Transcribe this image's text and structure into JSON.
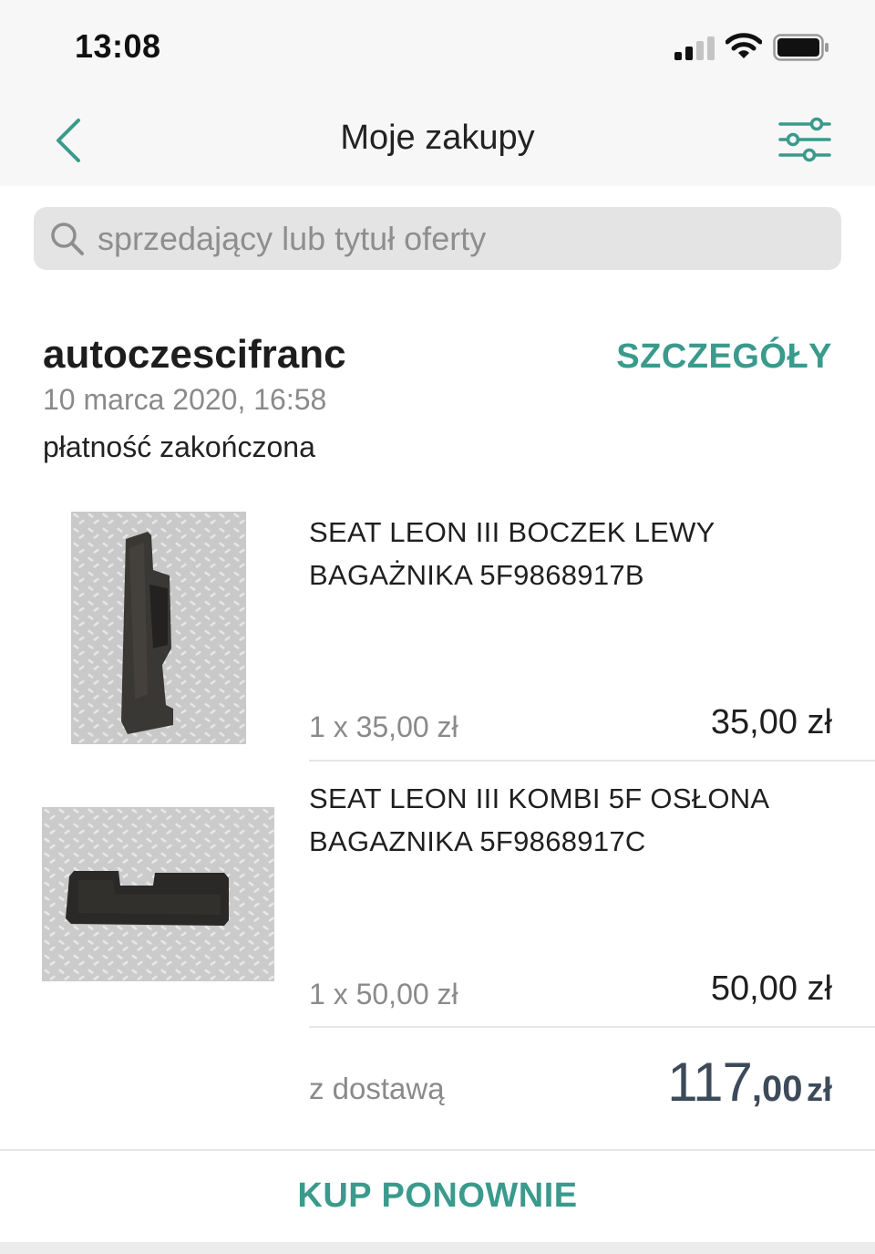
{
  "status_bar": {
    "time": "13:08",
    "icons": [
      "signal-icon",
      "wifi-icon",
      "battery-icon"
    ]
  },
  "nav": {
    "title": "Moje zakupy",
    "back_icon": "chevron-left-icon",
    "filter_icon": "sliders-icon"
  },
  "search": {
    "placeholder": "sprzedający lub tytuł oferty",
    "value": "",
    "icon": "search-icon"
  },
  "order": {
    "seller": "autoczescifranc",
    "details_label": "SZCZEGÓŁY",
    "date": "10 marca 2020, 16:58",
    "status": "płatność zakończona",
    "items": [
      {
        "title": "SEAT LEON III BOCZEK LEWY BAGAŻNIKA 5F9868917B",
        "quantity": "1 x 35,00 zł",
        "price": "35,00 zł"
      },
      {
        "title": "SEAT LEON III KOMBI 5F OSŁONA BAGAZNIKA 5F9868917C",
        "quantity": "1 x 50,00 zł",
        "price": "50,00 zł"
      }
    ],
    "delivery_label": "z dostawą",
    "total": {
      "integer": "117",
      "decimal": ",00",
      "currency": "zł"
    }
  },
  "footer": {
    "rebuy_label": "KUP PONOWNIE"
  },
  "colors": {
    "accent": "#3a9a8c",
    "total_text": "#3d4a59",
    "secondary_text": "#8a8a8a",
    "header_bg": "#f7f7f7",
    "search_bg": "#e4e4e4"
  }
}
